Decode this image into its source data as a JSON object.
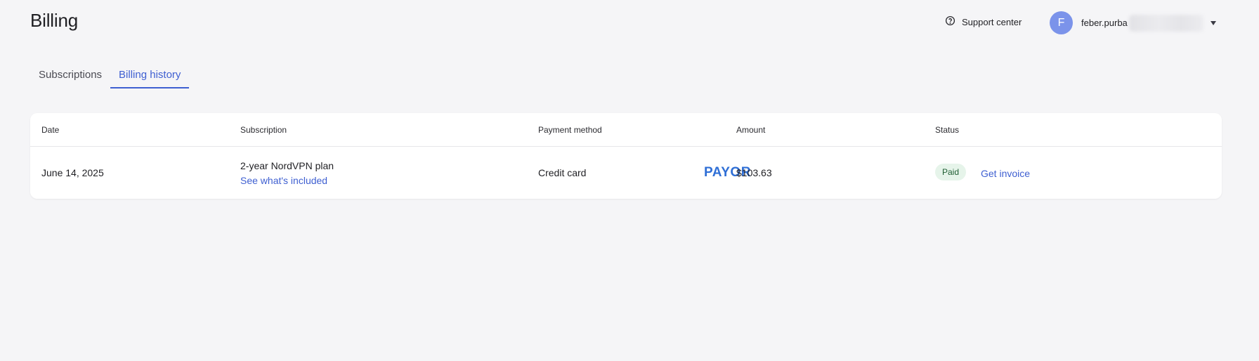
{
  "header": {
    "title": "Billing",
    "support_label": "Support center",
    "support_icon": "question-circle-icon",
    "avatar_initial": "F",
    "email_visible": "feber.purba",
    "dropdown_icon": "caret-down-icon"
  },
  "tabs": [
    {
      "label": "Subscriptions",
      "active": false
    },
    {
      "label": "Billing history",
      "active": true
    }
  ],
  "table": {
    "columns": [
      "Date",
      "Subscription",
      "Payment method",
      "Amount",
      "Status"
    ],
    "rows": [
      {
        "date": "June 14, 2025",
        "subscription": "2-year NordVPN plan",
        "subscription_link": "See what's included",
        "payment_method": "Credit card",
        "payment_logo": "PAYOR",
        "amount": "$103.63",
        "status": "Paid",
        "action": "Get invoice"
      }
    ]
  },
  "colors": {
    "accent": "#3e5fd1",
    "avatar": "#7b93ea",
    "paid_badge_bg": "#e6f4ea",
    "paid_badge_text": "#1f5e33",
    "background": "#f5f5f7"
  }
}
